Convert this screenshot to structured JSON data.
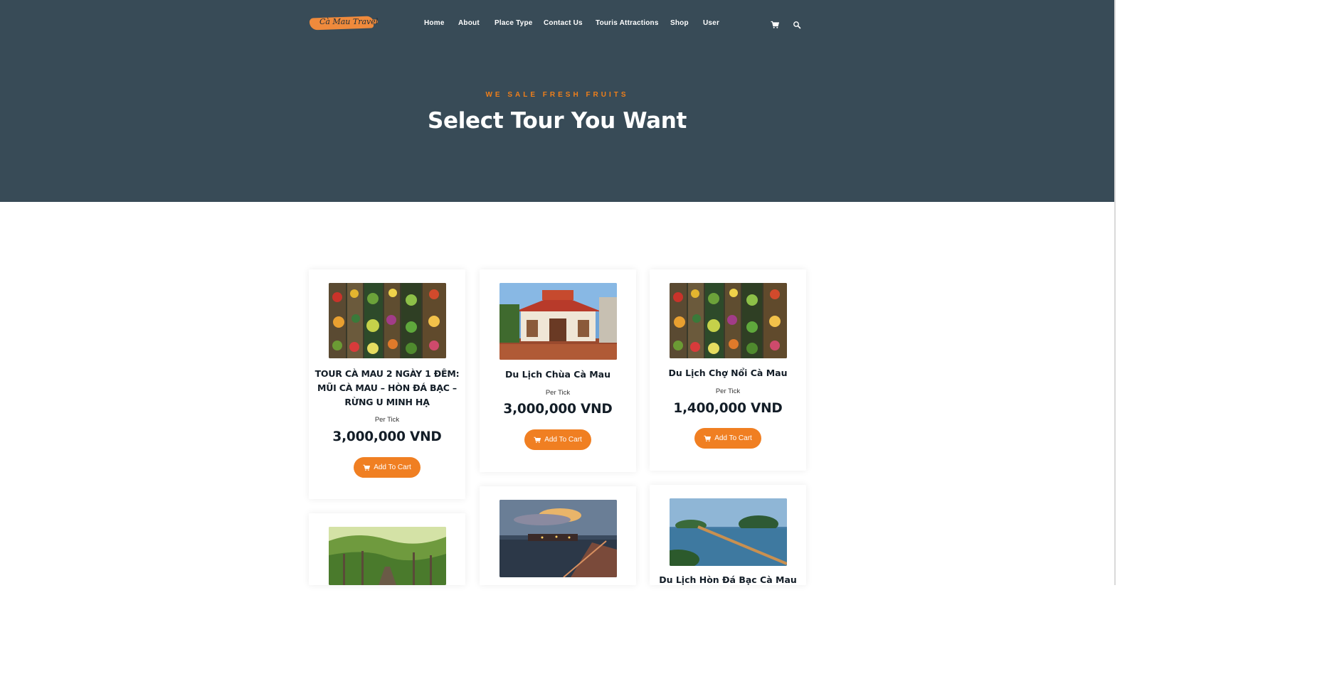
{
  "header": {
    "logo_text": "Cà Mau Travel",
    "nav": [
      "Home",
      "About",
      "Place Type",
      "Contact Us",
      "Touris Attractions",
      "Shop",
      "User"
    ],
    "icons": {
      "cart": "cart-icon",
      "search": "search-icon"
    }
  },
  "hero": {
    "kicker": "WE SALE FRESH FRUITS",
    "title": "Select Tour You Want"
  },
  "products": [
    {
      "name": "TOUR CÀ MAU 2 NGÀY 1 ĐÊM: MŨI CÀ MAU – HÒN ĐÁ BẠC – RỪNG U MINH HẠ",
      "per": "Per Tick",
      "price": "3,000,000 VND",
      "button": "Add To Cart",
      "image": "floating-market"
    },
    {
      "name": "Du Lịch Chùa Cà Mau",
      "per": "Per Tick",
      "price": "3,000,000 VND",
      "button": "Add To Cart",
      "image": "pagoda"
    },
    {
      "name": "Du Lịch Chợ Nổi Cà Mau",
      "per": "Per Tick",
      "price": "1,400,000 VND",
      "button": "Add To Cart",
      "image": "floating-market"
    },
    {
      "name": "",
      "image": "mangrove-forest"
    },
    {
      "name": "",
      "image": "sunset-pier"
    },
    {
      "name": "Du Lịch Hòn Đá Bạc Cà Mau",
      "image": "island-bridge"
    }
  ],
  "colors": {
    "hero_bg": "#384b57",
    "accent": "#f07f22"
  }
}
